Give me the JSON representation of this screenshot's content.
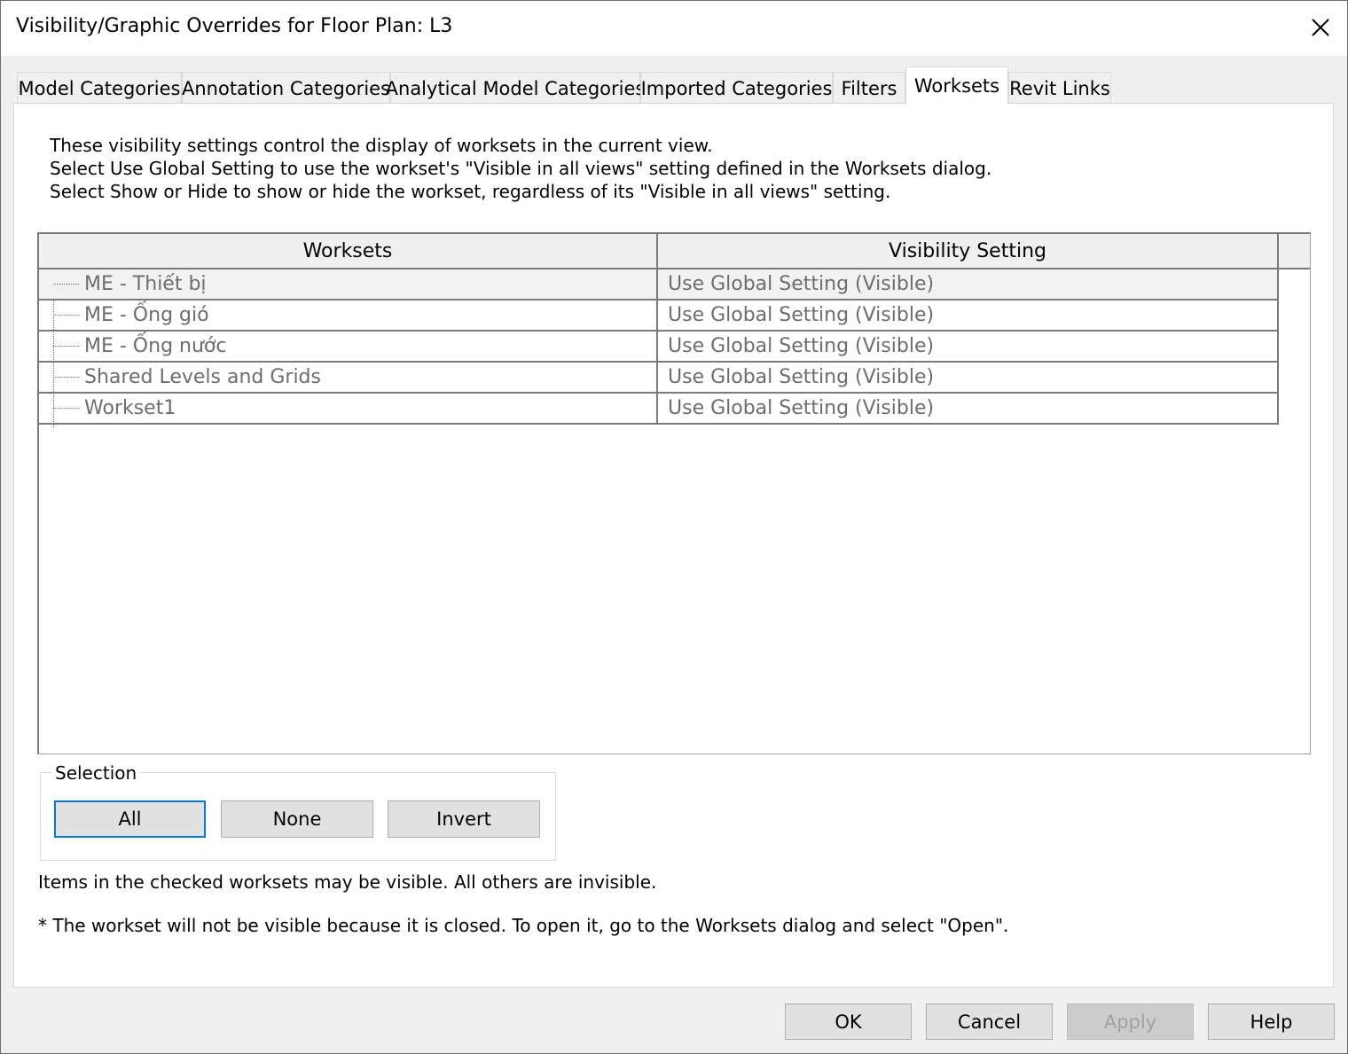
{
  "window": {
    "title": "Visibility/Graphic Overrides for Floor Plan: L3"
  },
  "tabs": [
    {
      "label": "Model Categories"
    },
    {
      "label": "Annotation Categories"
    },
    {
      "label": "Analytical Model Categories"
    },
    {
      "label": "Imported Categories"
    },
    {
      "label": "Filters"
    },
    {
      "label": "Worksets"
    },
    {
      "label": "Revit Links"
    }
  ],
  "active_tab": "Worksets",
  "description": {
    "line1": "These visibility settings control the display of worksets in the current view.",
    "line2": "Select Use Global Setting to use the workset's \"Visible in all views\" setting defined in the Worksets dialog.",
    "line3": "Select Show or Hide to show or hide the workset, regardless of its \"Visible in all views\" setting."
  },
  "grid": {
    "headers": {
      "worksets": "Worksets",
      "visibility": "Visibility Setting"
    },
    "rows": [
      {
        "workset": "ME - Thiết bị",
        "visibility": "Use Global Setting (Visible)"
      },
      {
        "workset": "ME - Ống gió",
        "visibility": "Use Global Setting (Visible)"
      },
      {
        "workset": "ME - Ống nước",
        "visibility": "Use Global Setting (Visible)"
      },
      {
        "workset": "Shared Levels and Grids",
        "visibility": "Use Global Setting (Visible)"
      },
      {
        "workset": "Workset1",
        "visibility": "Use Global Setting (Visible)"
      }
    ]
  },
  "selection": {
    "legend": "Selection",
    "all": "All",
    "none": "None",
    "invert": "Invert"
  },
  "notes": {
    "checked": "Items in the checked worksets may be visible.  All others are invisible.",
    "closed": "* The workset will not be visible because it is closed. To open it, go to the Worksets dialog and select \"Open\"."
  },
  "footer": {
    "ok": "OK",
    "cancel": "Cancel",
    "apply": "Apply",
    "help": "Help"
  },
  "icons": {
    "close": "close-icon"
  },
  "colors": {
    "focus_border": "#0078d7",
    "disabled_text": "#a0a0a0",
    "grid_text": "#6d6d6d"
  }
}
